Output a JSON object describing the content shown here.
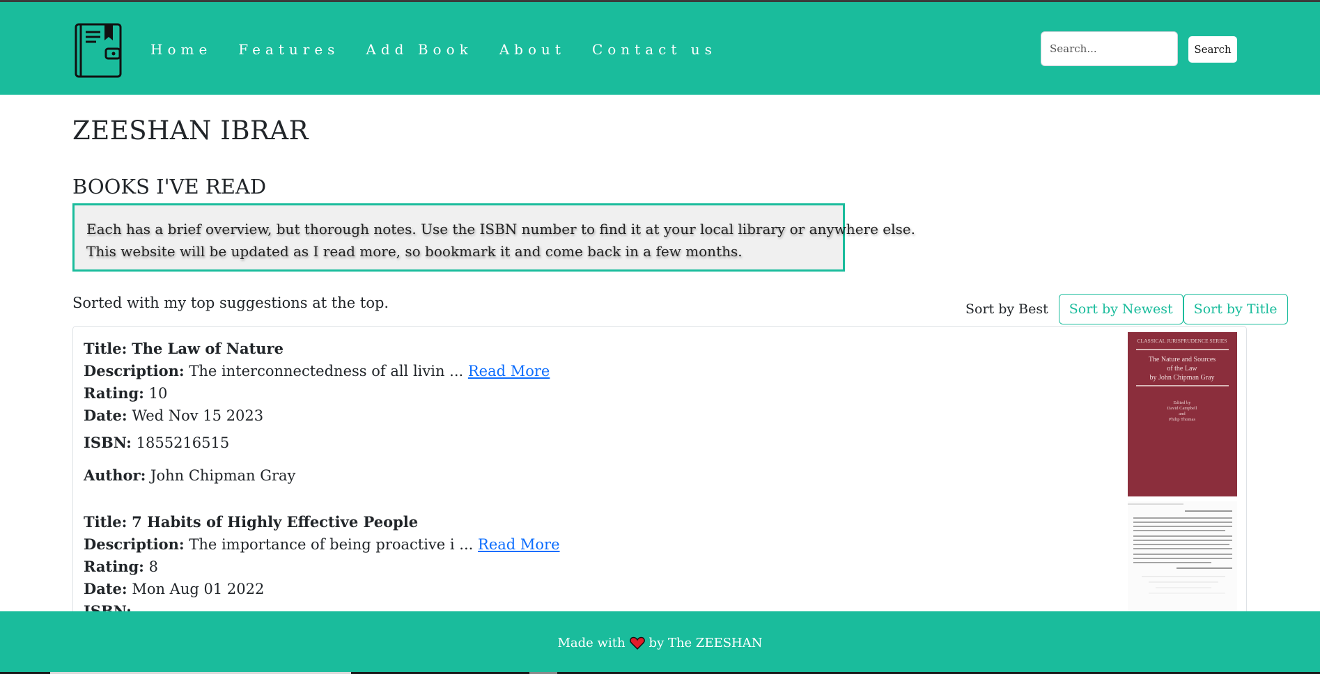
{
  "header": {
    "nav": [
      "Home",
      "Features",
      "Add Book",
      "About",
      "Contact us"
    ],
    "search_placeholder": "Search...",
    "search_button": "Search"
  },
  "main": {
    "title": "ZEESHAN IBRAR",
    "section_title": "BOOKS I'VE READ",
    "intro_line1": "Each has a brief overview, but thorough notes. Use the ISBN number to find it at your local library or anywhere else.",
    "intro_line2": "This website will be updated as I read more, so bookmark it and come back in a few months.",
    "sorted_note": "Sorted with my top suggestions at the top.",
    "sort_best": "Sort by Best",
    "sort_newest": "Sort by Newest",
    "sort_title": "Sort by Title"
  },
  "labels": {
    "title": "Title:",
    "description": "Description:",
    "rating": "Rating:",
    "date": "Date:",
    "isbn": "ISBN:",
    "author": "Author:",
    "read_more": "Read More"
  },
  "books": [
    {
      "title": "The Law of Nature",
      "description": "The interconnectedness of all livin ...",
      "rating": "10",
      "date": "Wed Nov 15 2023",
      "isbn": "1855216515",
      "author": "John Chipman Gray",
      "cover": {
        "series": "CLASSICAL JURISPRUDENCE SERIES",
        "title_line1": "The Nature and Sources",
        "title_line2": "of the Law",
        "title_line3": "by John Chipman Gray",
        "edited_line1": "Edited by",
        "edited_line2": "David Campbell",
        "edited_line3": "and",
        "edited_line4": "Philip Thomas",
        "color": "#8b2e3c"
      }
    },
    {
      "title": "7 Habits of Highly Effective People",
      "description": "The importance of being proactive i ...",
      "rating": "8",
      "date": "Mon Aug 01 2022",
      "isbn": "",
      "author": ""
    }
  ],
  "footer": {
    "made_with": "Made with",
    "by": "by The ZEESHAN"
  },
  "colors": {
    "accent": "#1abc9c",
    "link": "#0d6efd",
    "heart": "#e21d2b"
  }
}
